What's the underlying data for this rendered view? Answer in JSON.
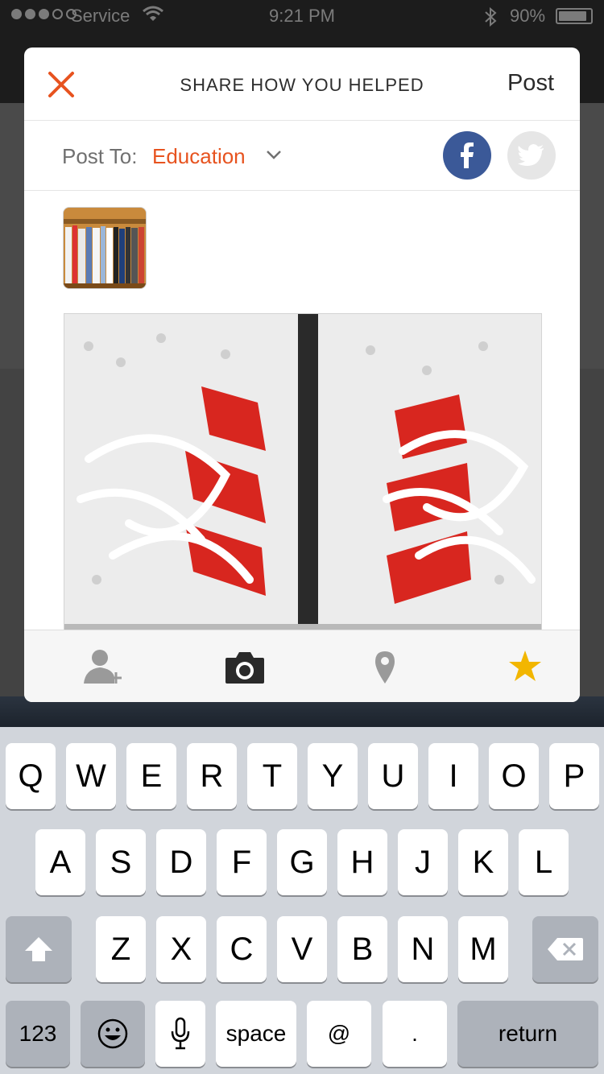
{
  "status_bar": {
    "carrier": "Service",
    "time": "9:21 PM",
    "battery": "90%",
    "battery_fraction": 0.9
  },
  "modal": {
    "title": "SHARE HOW YOU HELPED",
    "post_label": "Post",
    "post_to_label": "Post To:",
    "post_to_value": "Education",
    "accent_color": "#e7531f"
  },
  "toolbar": {
    "icons": [
      "add-person-icon",
      "camera-icon",
      "location-pin-icon",
      "star-icon"
    ]
  },
  "keyboard": {
    "row1": [
      "Q",
      "W",
      "E",
      "R",
      "T",
      "Y",
      "U",
      "I",
      "O",
      "P"
    ],
    "row2": [
      "A",
      "S",
      "D",
      "F",
      "G",
      "H",
      "J",
      "K",
      "L"
    ],
    "row3": [
      "Z",
      "X",
      "C",
      "V",
      "B",
      "N",
      "M"
    ],
    "numbers_label": "123",
    "space_label": "space",
    "at_label": "@",
    "period_label": ".",
    "return_label": "return"
  }
}
